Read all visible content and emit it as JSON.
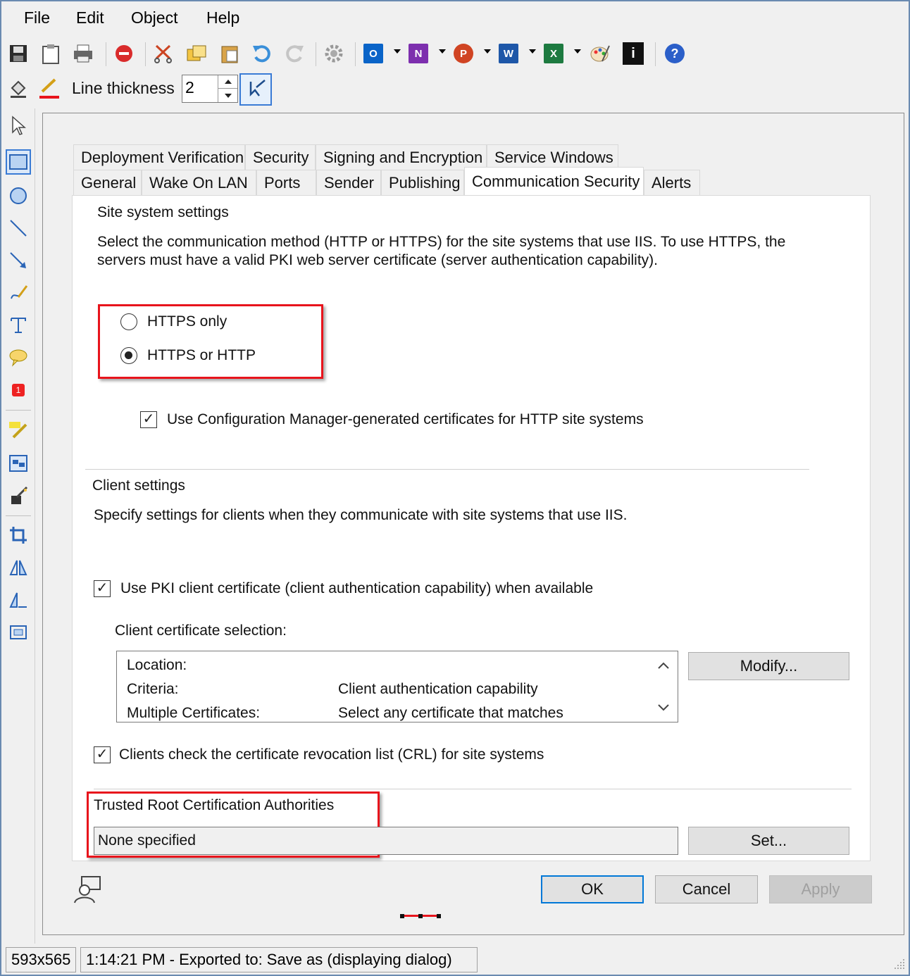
{
  "menu": [
    "File",
    "Edit",
    "Object",
    "Help"
  ],
  "toolbar": {
    "icons": [
      "save-icon",
      "clipboard-icon",
      "print-icon",
      "stop-icon",
      "cut-icon",
      "copy-icon",
      "paste-icon",
      "undo-icon",
      "redo-icon",
      "settings-icon",
      "outlook-icon",
      "onenote-icon",
      "powerpoint-icon",
      "word-icon",
      "excel-icon",
      "paint-icon",
      "info-icon",
      "help-icon"
    ],
    "office_letters": {
      "outlook": "O",
      "onenote": "N",
      "powerpoint": "P",
      "word": "W",
      "excel": "X"
    },
    "help_glyph": "?",
    "info_glyph": "i",
    "line_thickness_label": "Line thickness",
    "line_thickness_value": "2"
  },
  "tabs": {
    "row1": [
      "Deployment Verification",
      "Security",
      "Signing and Encryption",
      "Service Windows"
    ],
    "row2": [
      "General",
      "Wake On LAN",
      "Ports",
      "Sender",
      "Publishing",
      "Communication Security",
      "Alerts"
    ],
    "active": "Communication Security"
  },
  "site_system": {
    "heading": "Site system settings",
    "desc_line1": "Select the communication method (HTTP or HTTPS) for the site systems that use IIS. To use HTTPS, the",
    "desc_line2": "servers must have a valid PKI web server certificate (server authentication capability).",
    "radio_https_only": "HTTPS only",
    "radio_https_or_http": "HTTPS or HTTP",
    "selected": "HTTPS or HTTP",
    "use_cm_certs": "Use Configuration Manager-generated certificates for HTTP site systems",
    "use_cm_certs_checked": true
  },
  "client": {
    "heading": "Client settings",
    "desc": "Specify settings for clients when they communicate with site systems that use IIS.",
    "use_pki": "Use PKI client certificate (client authentication capability) when available",
    "use_pki_checked": true,
    "cert_selection_label": "Client certificate selection:",
    "cert_rows": [
      {
        "key": "Location:",
        "value": ""
      },
      {
        "key": "Criteria:",
        "value": "Client authentication capability"
      },
      {
        "key": "Multiple Certificates:",
        "value": "Select any certificate that matches"
      }
    ],
    "modify_button": "Modify...",
    "crl": "Clients check the certificate revocation list (CRL) for site systems",
    "crl_checked": true
  },
  "trusted_root": {
    "label": "Trusted Root Certification Authorities",
    "value": "None specified",
    "set_button": "Set..."
  },
  "dialog_buttons": {
    "ok": "OK",
    "cancel": "Cancel",
    "apply": "Apply"
  },
  "status": {
    "dimensions": "593x565",
    "message": "1:14:21 PM - Exported to: Save as (displaying dialog)"
  },
  "colors": {
    "highlight_red": "#e8141c",
    "accent_blue": "#0078d7"
  }
}
